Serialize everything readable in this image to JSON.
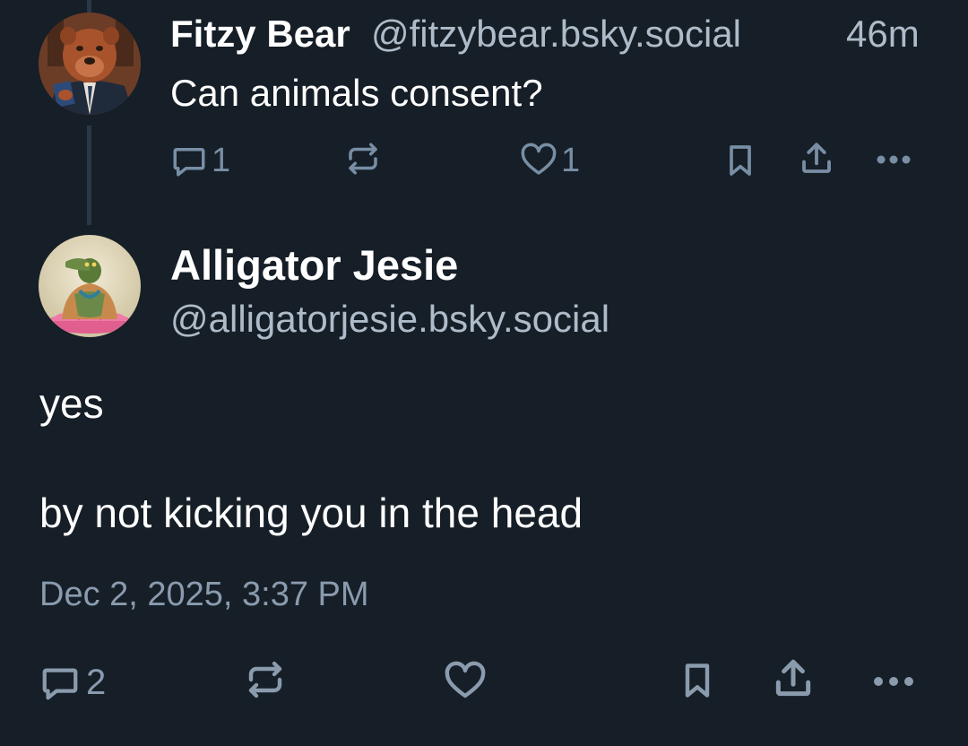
{
  "parent_post": {
    "author_name": "Fitzy Bear",
    "author_handle": "@fitzybear.bsky.social",
    "time_ago": "46m",
    "text": "Can animals consent?",
    "actions": {
      "reply_count": "1",
      "like_count": "1"
    },
    "avatar_icon": "bear-avatar"
  },
  "main_post": {
    "author_name": "Alligator Jesie",
    "author_handle": "@alligatorjesie.bsky.social",
    "text_lines": [
      "yes",
      "by not kicking you in the head"
    ],
    "timestamp": "Dec 2, 2025, 3:37 PM",
    "actions": {
      "reply_count": "2"
    },
    "avatar_icon": "alligator-avatar"
  },
  "colors": {
    "background": "#161e27",
    "text_primary": "#ffffff",
    "text_secondary": "#aebbc9",
    "icon": "#788ea5",
    "thread_line": "#2a3746"
  }
}
